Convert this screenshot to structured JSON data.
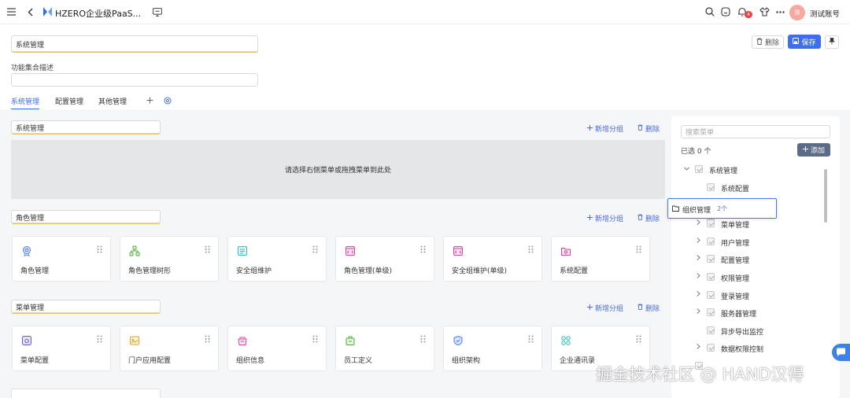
{
  "topbar": {
    "app_title": "HZERO企业级PaaS...",
    "notification_count": "4",
    "avatar_text": "测",
    "username": "测试账号"
  },
  "form": {
    "name_value": "系统管理",
    "description_label": "功能集合描述",
    "description_value": ""
  },
  "actions": {
    "delete_label": "删除",
    "save_label": "保存"
  },
  "tabs": [
    "系统管理",
    "配置管理",
    "其他管理"
  ],
  "groups": [
    {
      "title": "系统管理",
      "add_label": "新增分组",
      "delete_label": "删除",
      "empty_text": "请选择右侧菜单或拖拽菜单到此处"
    },
    {
      "title": "角色管理",
      "add_label": "新增分组",
      "delete_label": "删除",
      "cards": [
        "角色管理",
        "角色管理树形",
        "安全组维护",
        "角色管理(单级)",
        "安全组维护(单级)",
        "系统配置"
      ]
    },
    {
      "title": "菜单管理",
      "add_label": "新增分组",
      "delete_label": "删除",
      "cards": [
        "菜单配置",
        "门户应用配置",
        "组织信息",
        "员工定义",
        "组织架构",
        "企业通讯录"
      ]
    }
  ],
  "panel": {
    "search_placeholder": "搜索菜单",
    "selected_text": "已选 0 个",
    "add_label": "添加",
    "tree": [
      {
        "label": "系统管理",
        "level": 0,
        "arrow": "down"
      },
      {
        "label": "系统配置",
        "level": 1,
        "arrow": ""
      },
      {
        "label": "菜单管理",
        "level": 1,
        "arrow": "right"
      },
      {
        "label": "用户管理",
        "level": 1,
        "arrow": "right"
      },
      {
        "label": "配置管理",
        "level": 1,
        "arrow": "right"
      },
      {
        "label": "权限管理",
        "level": 1,
        "arrow": "right"
      },
      {
        "label": "登录管理",
        "level": 1,
        "arrow": "right"
      },
      {
        "label": "服务器管理",
        "level": 1,
        "arrow": "right"
      },
      {
        "label": "异步导出监控",
        "level": 1,
        "arrow": ""
      },
      {
        "label": "数据权限控制",
        "level": 1,
        "arrow": "right"
      }
    ],
    "drag_item": {
      "label": "组织管理",
      "count": "2个"
    }
  },
  "watermark": "掘金技术社区 @ HAND汉得"
}
